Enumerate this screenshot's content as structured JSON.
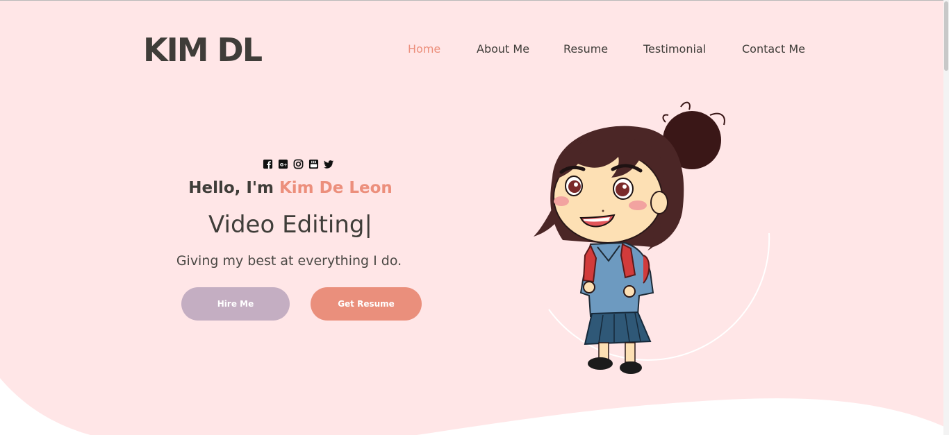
{
  "brand": {
    "logo_text": "KIM DL"
  },
  "nav": {
    "items": [
      {
        "label": "Home",
        "active": true
      },
      {
        "label": "About Me",
        "active": false
      },
      {
        "label": "Resume",
        "active": false
      },
      {
        "label": "Testimonial",
        "active": false
      },
      {
        "label": "Contact Me",
        "active": false
      }
    ]
  },
  "social_icons": [
    "facebook-icon",
    "google-plus-icon",
    "instagram-icon",
    "youtube-icon",
    "twitter-icon"
  ],
  "hero": {
    "greeting_prefix": "Hello, I'm ",
    "name": "Kim De Leon",
    "role_text": "Video Editing|",
    "tagline": "Giving my best at everything I do.",
    "hire_button": "Hire Me",
    "resume_button": "Get Resume"
  },
  "colors": {
    "background": "#ffe6e7",
    "accent": "#ec8f7c",
    "hire_button": "#c4aec2",
    "text": "#3f3d39"
  }
}
